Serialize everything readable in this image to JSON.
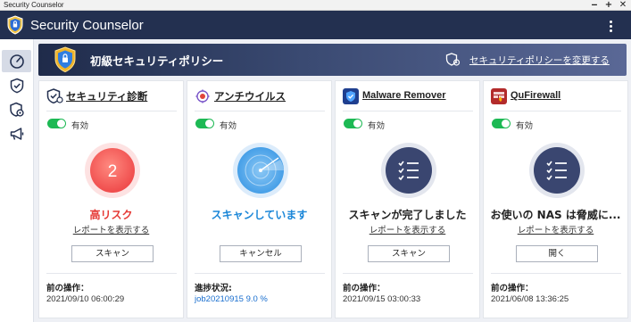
{
  "os": {
    "title": "Security Counselor",
    "controls": [
      "‒",
      "+",
      "✕"
    ]
  },
  "app": {
    "title": "Security Counselor",
    "accent": "#233050"
  },
  "sidebar": {
    "items": [
      {
        "icon": "dashboard-gauge-icon",
        "active": true
      },
      {
        "icon": "shield-check-icon",
        "active": false
      },
      {
        "icon": "shield-gear-icon",
        "active": false
      },
      {
        "icon": "megaphone-icon",
        "active": false
      }
    ]
  },
  "banner": {
    "title": "初級セキュリティポリシー",
    "link": "セキュリティポリシーを変更する"
  },
  "cards": [
    {
      "title": "セキュリティ診断",
      "icon": "shield-check-icon",
      "toggle_label": "有効",
      "gauge_value": "2",
      "status": "高リスク",
      "status_color": "#e53935",
      "report_link": "レポートを表示する",
      "button": "スキャン",
      "meta_label": "前の操作：",
      "meta_value": "2021/09/10 06:00:29"
    },
    {
      "title": "アンチウイルス",
      "icon": "antivirus-icon",
      "toggle_label": "有効",
      "status": "スキャンしています",
      "status_color": "#1a86d8",
      "button": "キャンセル",
      "meta_label": "進捗状況:",
      "meta_value": "job20210915 9.0 %"
    },
    {
      "title": "Malware Remover",
      "icon": "malware-remover-icon",
      "toggle_label": "有効",
      "status": "スキャンが完了しました",
      "status_color": "#222222",
      "report_link": "レポートを表示する",
      "button": "スキャン",
      "meta_label": "前の操作：",
      "meta_value": "2021/09/15 03:00:33"
    },
    {
      "title": "QuFirewall",
      "icon": "qufirewall-icon",
      "toggle_label": "有効",
      "status": "お使いの NAS は脅威に...",
      "status_color": "#222222",
      "report_link": "レポートを表示する",
      "button": "開く",
      "meta_label": "前の操作：",
      "meta_value": "2021/06/08 13:36:25"
    }
  ]
}
